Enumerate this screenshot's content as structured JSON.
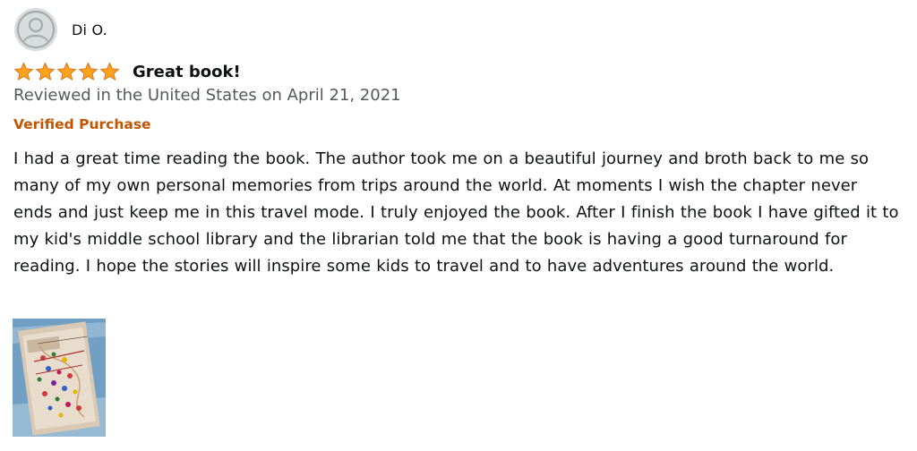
{
  "reviewer": {
    "name": "Di O.",
    "avatar_icon": "default-profile-icon"
  },
  "review": {
    "rating": 5,
    "rating_max": 5,
    "star_color": "#ffa41c",
    "title": "Great book!",
    "date_text": "Reviewed in the United States on April 21, 2021",
    "verified_label": "Verified Purchase",
    "verified_color": "#c45500",
    "body": "I had a great time reading the book. The author took me on a beautiful journey and broth back to me so many of my own personal memories from trips around the world. At moments I wish the chapter never ends and just keep me in this travel mode. I truly enjoyed the book. After I finish the book I have gifted it to my kid's middle school library and the librarian told me that the book is having a good turnaround for reading. I hope the stories will inspire some kids to travel and to have adventures around the world."
  },
  "images": [
    {
      "name": "review-photo-thumbnail"
    }
  ]
}
